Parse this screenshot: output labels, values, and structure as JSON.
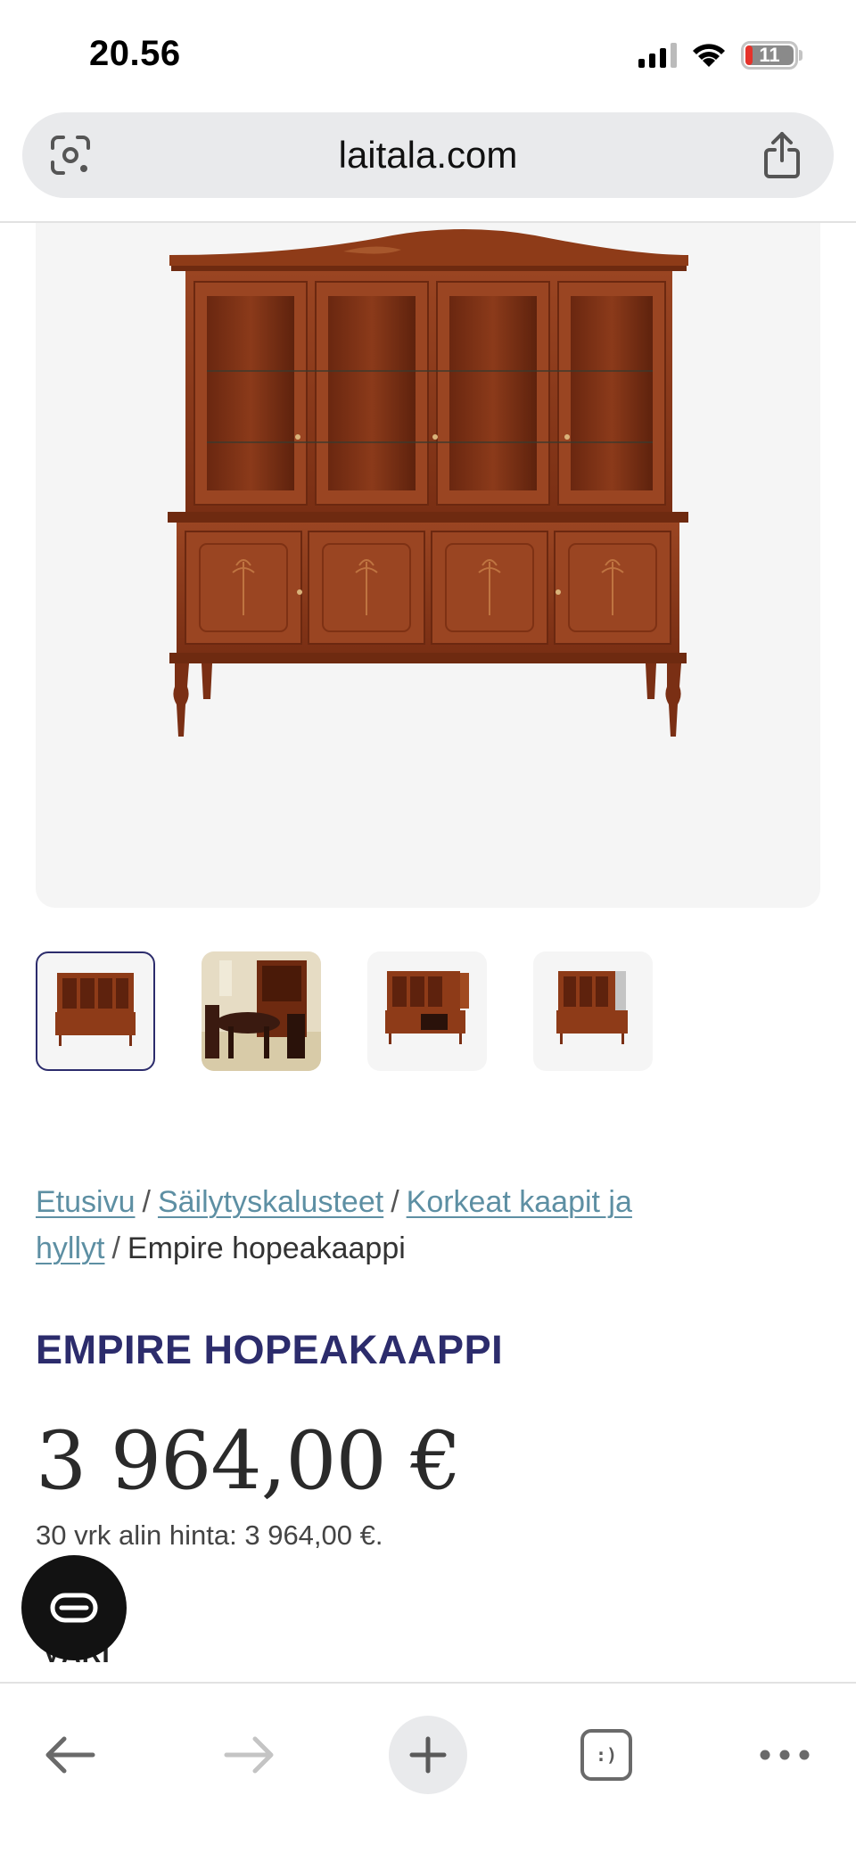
{
  "status_bar": {
    "time": "20.56",
    "battery_level": "11",
    "icons": [
      "cellular-signal-icon",
      "wifi-icon",
      "battery-icon"
    ]
  },
  "browser": {
    "url": "laitala.com",
    "icons": [
      "google-lens-icon",
      "share-icon"
    ]
  },
  "gallery": {
    "main_image": "wooden-display-cabinet-image",
    "thumbnails": [
      "cabinet-front",
      "cabinet-dining-room",
      "cabinet-open-doors",
      "cabinet-angle"
    ],
    "active_thumbnail_index": 0
  },
  "breadcrumb": {
    "items": [
      "Etusivu",
      "Säilytyskalusteet",
      "Korkeat kaapit ja hyllyt"
    ],
    "separator": "/",
    "current": "Empire hopeakaappi"
  },
  "product": {
    "title": "EMPIRE HOPEAKAAPPI",
    "price": "3 964,00 €",
    "lowest_price_note": "30 vrk alin hinta: 3 964,00 €.",
    "section_label": "VÄRI"
  },
  "toolbar": {
    "icons": [
      "back-arrow-icon",
      "forward-arrow-icon",
      "new-tab-plus-icon",
      "tabs-icon",
      "more-icon"
    ],
    "tab_glyph": ":)"
  },
  "colors": {
    "brand_navy": "#2c2c6c",
    "link": "#5d8fa3",
    "wood": "#8b3a1a"
  }
}
